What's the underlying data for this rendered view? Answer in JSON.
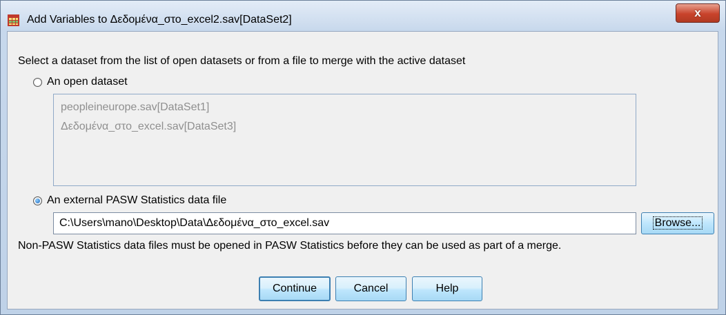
{
  "window": {
    "title": "Add Variables to Δεδομένα_στο_excel2.sav[DataSet2]",
    "close_glyph": "x"
  },
  "instruction": "Select a dataset from the list of open datasets or from a file to merge with the active dataset",
  "open_dataset": {
    "label": "An open dataset",
    "selected": false,
    "items": [
      "peopleineurope.sav[DataSet1]",
      "Δεδομένα_στο_excel.sav[DataSet3]"
    ]
  },
  "external_file": {
    "label": "An external PASW Statistics data file",
    "selected": true,
    "path": "C:\\Users\\mano\\Desktop\\Data\\Δεδομένα_στο_excel.sav",
    "browse_label": "Browse..."
  },
  "note": "Non-PASW Statistics data files must be opened in PASW Statistics before they can be used as part of a merge.",
  "buttons": {
    "continue": "Continue",
    "cancel": "Cancel",
    "help": "Help"
  },
  "colors": {
    "accent": "#3c7fb1",
    "close_red": "#c8432b",
    "disabled_text": "#8f8f8f"
  },
  "icons": {
    "app": "spss-data-grid-icon",
    "close": "close-icon"
  }
}
